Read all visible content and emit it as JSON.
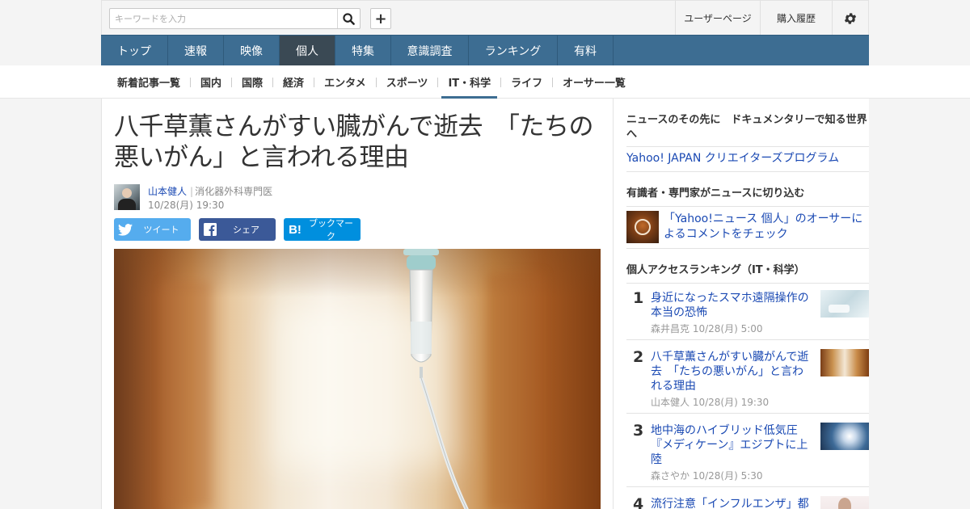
{
  "header": {
    "search_placeholder": "キーワードを入力",
    "links": {
      "user_page": "ユーザーページ",
      "history": "購入履歴"
    }
  },
  "global_nav": [
    "トップ",
    "速報",
    "映像",
    "個人",
    "特集",
    "意識調査",
    "ランキング",
    "有料"
  ],
  "sub_nav": [
    "新着記事一覧",
    "国内",
    "国際",
    "経済",
    "エンタメ",
    "スポーツ",
    "IT・科学",
    "ライフ",
    "オーサー一覧"
  ],
  "article": {
    "title": "八千草薫さんがすい臓がんで逝去　「たちの悪いがん」と言われる理由",
    "author": "山本健人",
    "author_title": "消化器外科専門医",
    "date": "10/28(月) 19:30",
    "share": {
      "tweet": "ツイート",
      "facebook": "シェア",
      "hatena": "ブックマーク"
    }
  },
  "sidebar": {
    "doc_title": "ニュースのその先に　ドキュメンタリーで知る世界へ",
    "doc_link": "Yahoo! JAPAN クリエイターズプログラム",
    "expert_title": "有識者・専門家がニュースに切り込む",
    "expert_link": "「Yahoo!ニュース 個人」のオーサーによるコメントをチェック",
    "ranking_title": "個人アクセスランキング（IT・科学）",
    "ranking": [
      {
        "rank": "1",
        "title": "身近になったスマホ遠隔操作の本当の恐怖",
        "author": "森井昌克",
        "date": "10/28(月) 5:00"
      },
      {
        "rank": "2",
        "title": "八千草薫さんがすい臓がんで逝去　「たちの悪いがん」と言われる理由",
        "author": "山本健人",
        "date": "10/28(月) 19:30"
      },
      {
        "rank": "3",
        "title": "地中海のハイブリッド低気圧『メディケーン』エジプトに上陸",
        "author": "森さやか",
        "date": "10/28(月) 5:30"
      },
      {
        "rank": "4",
        "title": "流行注意「インフルエンザ」都",
        "author": "",
        "date": ""
      }
    ]
  }
}
